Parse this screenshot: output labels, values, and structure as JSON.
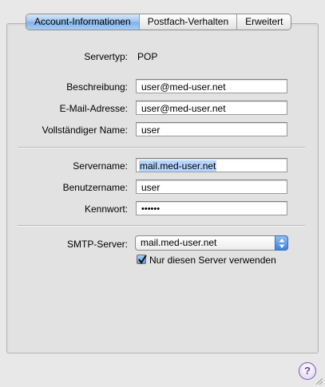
{
  "tabs": [
    {
      "label": "Account-Informationen",
      "active": true
    },
    {
      "label": "Postfach-Verhalten",
      "active": false
    },
    {
      "label": "Erweitert",
      "active": false
    }
  ],
  "account": {
    "servertyp_label": "Servertyp:",
    "servertyp_value": "POP",
    "beschreibung_label": "Beschreibung:",
    "beschreibung_value": "user@med-user.net",
    "email_label": "E-Mail-Adresse:",
    "email_value": "user@med-user.net",
    "name_label": "Vollständiger Name:",
    "name_value": "user"
  },
  "incoming": {
    "servername_label": "Servername:",
    "servername_value": "mail.med-user.net",
    "benutzername_label": "Benutzername:",
    "benutzername_value": "user",
    "kennwort_label": "Kennwort:",
    "kennwort_value": "••••••"
  },
  "smtp": {
    "label": "SMTP-Server:",
    "selected": "mail.med-user.net",
    "only_this_server_label": "Nur diesen Server verwenden",
    "only_this_server_checked": true
  },
  "help": {
    "glyph": "?"
  },
  "colors": {
    "accent": "#3b83e0",
    "tab_active": "#9cc3ef",
    "selection": "#b5d5ff"
  }
}
